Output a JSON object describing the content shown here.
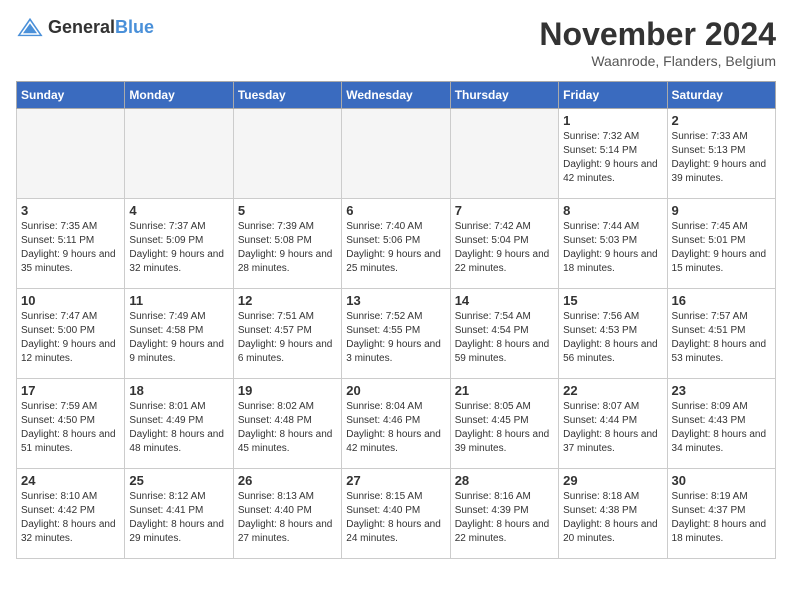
{
  "header": {
    "logo_general": "General",
    "logo_blue": "Blue",
    "title": "November 2024",
    "location": "Waanrode, Flanders, Belgium"
  },
  "columns": [
    "Sunday",
    "Monday",
    "Tuesday",
    "Wednesday",
    "Thursday",
    "Friday",
    "Saturday"
  ],
  "weeks": [
    [
      {
        "day": "",
        "info": ""
      },
      {
        "day": "",
        "info": ""
      },
      {
        "day": "",
        "info": ""
      },
      {
        "day": "",
        "info": ""
      },
      {
        "day": "",
        "info": ""
      },
      {
        "day": "1",
        "info": "Sunrise: 7:32 AM\nSunset: 5:14 PM\nDaylight: 9 hours and 42 minutes."
      },
      {
        "day": "2",
        "info": "Sunrise: 7:33 AM\nSunset: 5:13 PM\nDaylight: 9 hours and 39 minutes."
      }
    ],
    [
      {
        "day": "3",
        "info": "Sunrise: 7:35 AM\nSunset: 5:11 PM\nDaylight: 9 hours and 35 minutes."
      },
      {
        "day": "4",
        "info": "Sunrise: 7:37 AM\nSunset: 5:09 PM\nDaylight: 9 hours and 32 minutes."
      },
      {
        "day": "5",
        "info": "Sunrise: 7:39 AM\nSunset: 5:08 PM\nDaylight: 9 hours and 28 minutes."
      },
      {
        "day": "6",
        "info": "Sunrise: 7:40 AM\nSunset: 5:06 PM\nDaylight: 9 hours and 25 minutes."
      },
      {
        "day": "7",
        "info": "Sunrise: 7:42 AM\nSunset: 5:04 PM\nDaylight: 9 hours and 22 minutes."
      },
      {
        "day": "8",
        "info": "Sunrise: 7:44 AM\nSunset: 5:03 PM\nDaylight: 9 hours and 18 minutes."
      },
      {
        "day": "9",
        "info": "Sunrise: 7:45 AM\nSunset: 5:01 PM\nDaylight: 9 hours and 15 minutes."
      }
    ],
    [
      {
        "day": "10",
        "info": "Sunrise: 7:47 AM\nSunset: 5:00 PM\nDaylight: 9 hours and 12 minutes."
      },
      {
        "day": "11",
        "info": "Sunrise: 7:49 AM\nSunset: 4:58 PM\nDaylight: 9 hours and 9 minutes."
      },
      {
        "day": "12",
        "info": "Sunrise: 7:51 AM\nSunset: 4:57 PM\nDaylight: 9 hours and 6 minutes."
      },
      {
        "day": "13",
        "info": "Sunrise: 7:52 AM\nSunset: 4:55 PM\nDaylight: 9 hours and 3 minutes."
      },
      {
        "day": "14",
        "info": "Sunrise: 7:54 AM\nSunset: 4:54 PM\nDaylight: 8 hours and 59 minutes."
      },
      {
        "day": "15",
        "info": "Sunrise: 7:56 AM\nSunset: 4:53 PM\nDaylight: 8 hours and 56 minutes."
      },
      {
        "day": "16",
        "info": "Sunrise: 7:57 AM\nSunset: 4:51 PM\nDaylight: 8 hours and 53 minutes."
      }
    ],
    [
      {
        "day": "17",
        "info": "Sunrise: 7:59 AM\nSunset: 4:50 PM\nDaylight: 8 hours and 51 minutes."
      },
      {
        "day": "18",
        "info": "Sunrise: 8:01 AM\nSunset: 4:49 PM\nDaylight: 8 hours and 48 minutes."
      },
      {
        "day": "19",
        "info": "Sunrise: 8:02 AM\nSunset: 4:48 PM\nDaylight: 8 hours and 45 minutes."
      },
      {
        "day": "20",
        "info": "Sunrise: 8:04 AM\nSunset: 4:46 PM\nDaylight: 8 hours and 42 minutes."
      },
      {
        "day": "21",
        "info": "Sunrise: 8:05 AM\nSunset: 4:45 PM\nDaylight: 8 hours and 39 minutes."
      },
      {
        "day": "22",
        "info": "Sunrise: 8:07 AM\nSunset: 4:44 PM\nDaylight: 8 hours and 37 minutes."
      },
      {
        "day": "23",
        "info": "Sunrise: 8:09 AM\nSunset: 4:43 PM\nDaylight: 8 hours and 34 minutes."
      }
    ],
    [
      {
        "day": "24",
        "info": "Sunrise: 8:10 AM\nSunset: 4:42 PM\nDaylight: 8 hours and 32 minutes."
      },
      {
        "day": "25",
        "info": "Sunrise: 8:12 AM\nSunset: 4:41 PM\nDaylight: 8 hours and 29 minutes."
      },
      {
        "day": "26",
        "info": "Sunrise: 8:13 AM\nSunset: 4:40 PM\nDaylight: 8 hours and 27 minutes."
      },
      {
        "day": "27",
        "info": "Sunrise: 8:15 AM\nSunset: 4:40 PM\nDaylight: 8 hours and 24 minutes."
      },
      {
        "day": "28",
        "info": "Sunrise: 8:16 AM\nSunset: 4:39 PM\nDaylight: 8 hours and 22 minutes."
      },
      {
        "day": "29",
        "info": "Sunrise: 8:18 AM\nSunset: 4:38 PM\nDaylight: 8 hours and 20 minutes."
      },
      {
        "day": "30",
        "info": "Sunrise: 8:19 AM\nSunset: 4:37 PM\nDaylight: 8 hours and 18 minutes."
      }
    ]
  ]
}
